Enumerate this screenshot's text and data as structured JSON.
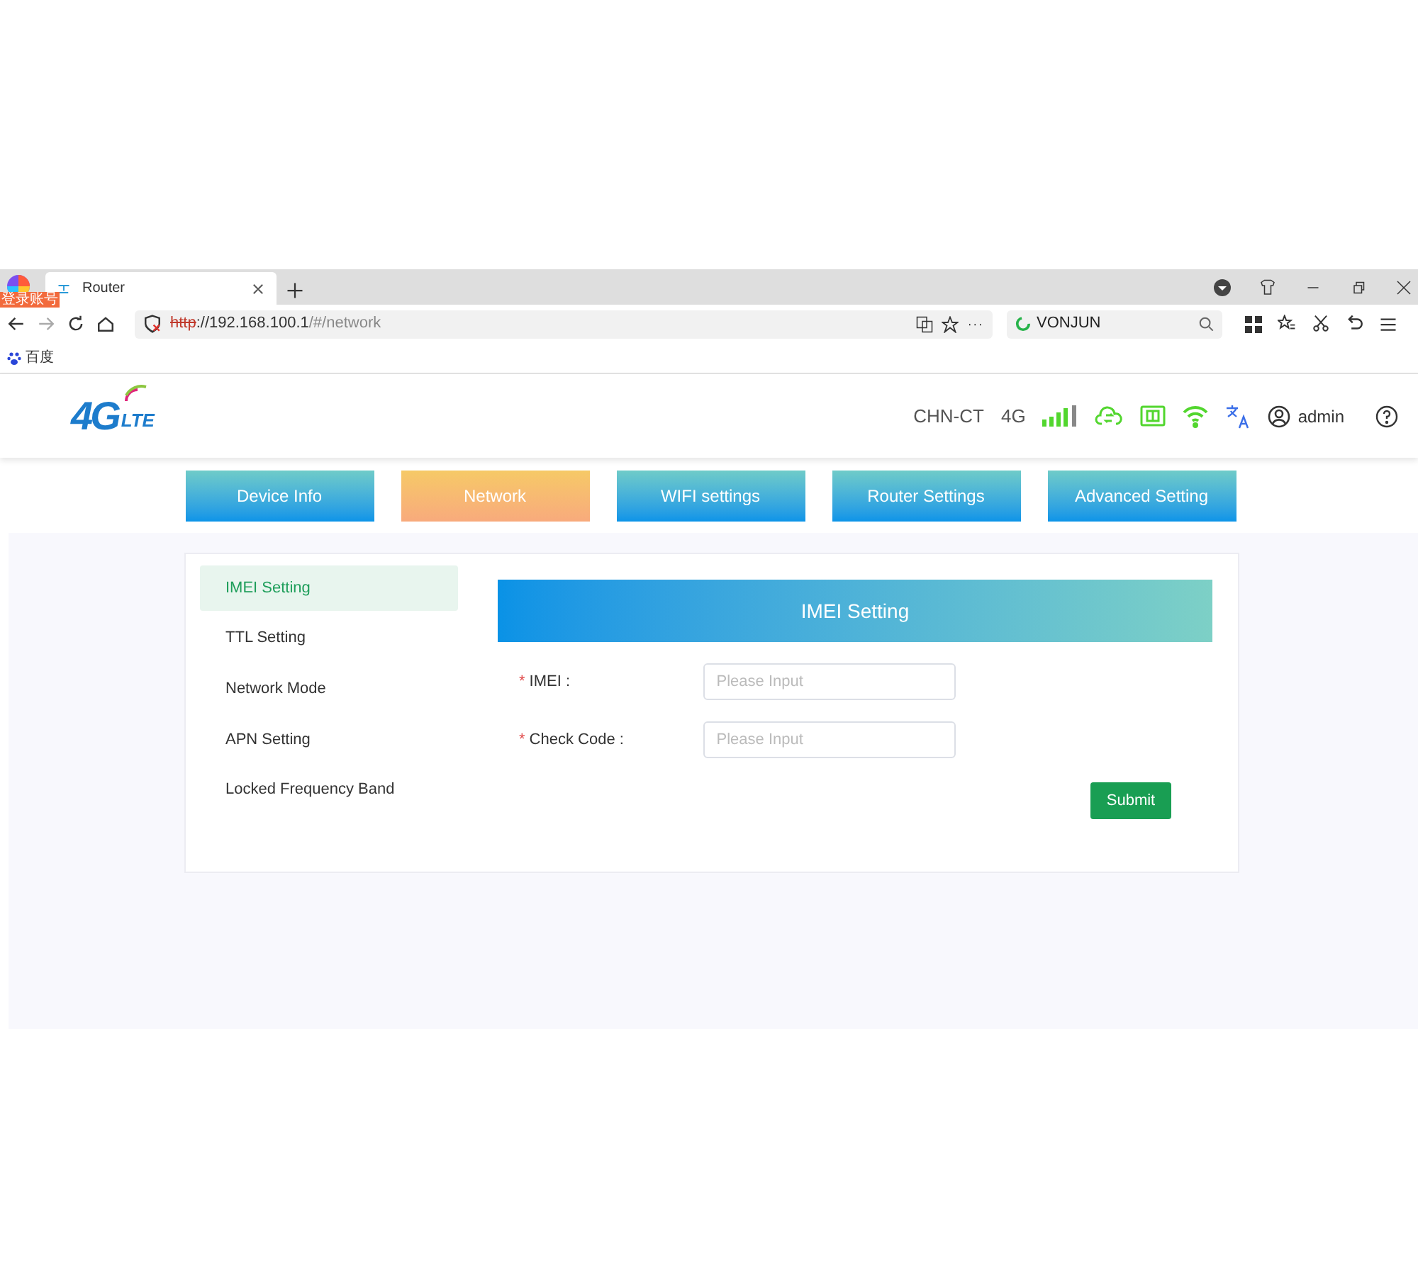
{
  "browser": {
    "account_badge": "登录账号",
    "tab": {
      "title": "Router"
    },
    "url": {
      "scheme": "http",
      "host": "://192.168.100.1",
      "path": "/#/network"
    },
    "search": {
      "value": "VONJUN"
    },
    "bookmarks": [
      "百度"
    ]
  },
  "header": {
    "logo": {
      "main": "4G",
      "sub": "LTE"
    },
    "carrier": "CHN-CT",
    "network_type": "4G",
    "user": "admin"
  },
  "nav": [
    {
      "label": "Device Info",
      "selected": false
    },
    {
      "label": "Network",
      "selected": true
    },
    {
      "label": "WIFI settings",
      "selected": false
    },
    {
      "label": "Router Settings",
      "selected": false
    },
    {
      "label": "Advanced Setting",
      "selected": false
    }
  ],
  "sidebar": {
    "items": [
      {
        "label": "IMEI Setting",
        "selected": true
      },
      {
        "label": "TTL Setting",
        "selected": false
      },
      {
        "label": "Network Mode",
        "selected": false
      },
      {
        "label": "APN Setting",
        "selected": false
      },
      {
        "label": "Locked Frequency Band",
        "selected": false
      }
    ]
  },
  "form": {
    "title": "IMEI Setting",
    "fields": [
      {
        "mark": "*",
        "label": "IMEI :",
        "placeholder": "Please Input"
      },
      {
        "mark": "*",
        "label": "Check Code :",
        "placeholder": "Please Input"
      }
    ],
    "submit": "Submit"
  }
}
